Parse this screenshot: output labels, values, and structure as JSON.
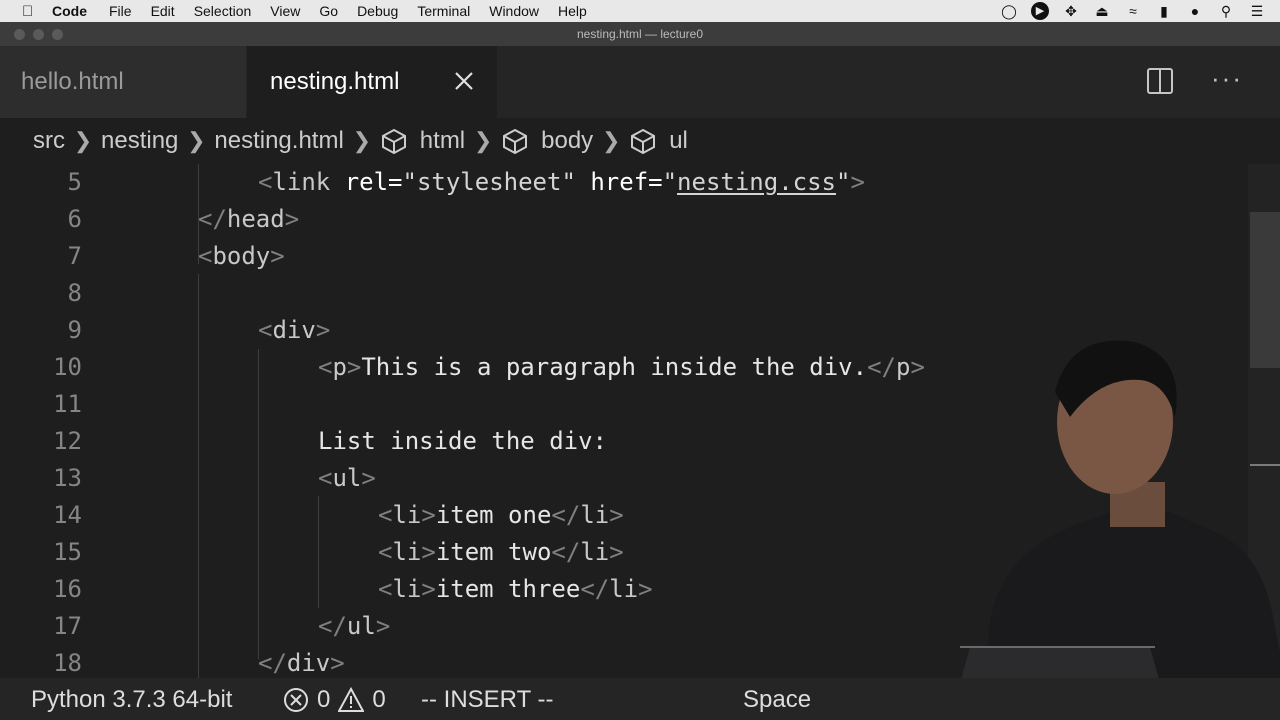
{
  "menubar": {
    "app": "Code",
    "items": [
      "File",
      "Edit",
      "Selection",
      "View",
      "Go",
      "Debug",
      "Terminal",
      "Window",
      "Help"
    ]
  },
  "window": {
    "title": "nesting.html — lecture0"
  },
  "tabs": [
    {
      "label": "hello.html",
      "active": false
    },
    {
      "label": "nesting.html",
      "active": true
    }
  ],
  "breadcrumb": [
    "src",
    "nesting",
    "nesting.html",
    "html",
    "body",
    "ul"
  ],
  "editor": {
    "lines": [
      {
        "num": "5",
        "tokens": [
          [
            "punct",
            "<"
          ],
          [
            "tag",
            "link "
          ],
          [
            "attr",
            "rel="
          ],
          [
            "str",
            "\"stylesheet\" "
          ],
          [
            "attr",
            "href="
          ],
          [
            "str",
            "\""
          ],
          [
            "link",
            "nesting.css"
          ],
          [
            "str",
            "\""
          ],
          [
            "punct",
            ">"
          ]
        ]
      },
      {
        "num": "6",
        "tokens": [
          [
            "punct",
            "</"
          ],
          [
            "tag",
            "head"
          ],
          [
            "punct",
            ">"
          ]
        ]
      },
      {
        "num": "7",
        "tokens": [
          [
            "punct",
            "<"
          ],
          [
            "tag",
            "body"
          ],
          [
            "punct",
            ">"
          ]
        ]
      },
      {
        "num": "8",
        "tokens": []
      },
      {
        "num": "9",
        "tokens": [
          [
            "punct",
            "<"
          ],
          [
            "tag",
            "div"
          ],
          [
            "punct",
            ">"
          ]
        ]
      },
      {
        "num": "10",
        "tokens": [
          [
            "punct",
            "<"
          ],
          [
            "tag",
            "p"
          ],
          [
            "punct",
            ">"
          ],
          [
            "txt",
            "This is a paragraph inside the div."
          ],
          [
            "punct",
            "</"
          ],
          [
            "tag",
            "p"
          ],
          [
            "punct",
            ">"
          ]
        ]
      },
      {
        "num": "11",
        "tokens": []
      },
      {
        "num": "12",
        "tokens": [
          [
            "txt",
            "List inside the div:"
          ]
        ]
      },
      {
        "num": "13",
        "tokens": [
          [
            "punct",
            "<"
          ],
          [
            "tag",
            "ul"
          ],
          [
            "punct",
            ">"
          ]
        ]
      },
      {
        "num": "14",
        "tokens": [
          [
            "punct",
            "<"
          ],
          [
            "tag",
            "li"
          ],
          [
            "punct",
            ">"
          ],
          [
            "txt",
            "item one"
          ],
          [
            "punct",
            "</"
          ],
          [
            "tag",
            "li"
          ],
          [
            "punct",
            ">"
          ]
        ]
      },
      {
        "num": "15",
        "tokens": [
          [
            "punct",
            "<"
          ],
          [
            "tag",
            "li"
          ],
          [
            "punct",
            ">"
          ],
          [
            "txt",
            "item two"
          ],
          [
            "punct",
            "</"
          ],
          [
            "tag",
            "li"
          ],
          [
            "punct",
            ">"
          ]
        ]
      },
      {
        "num": "16",
        "tokens": [
          [
            "punct",
            "<"
          ],
          [
            "tag",
            "li"
          ],
          [
            "punct",
            ">"
          ],
          [
            "txt",
            "item three"
          ],
          [
            "punct",
            "</"
          ],
          [
            "tag",
            "li"
          ],
          [
            "punct",
            ">"
          ]
        ]
      },
      {
        "num": "17",
        "tokens": [
          [
            "punct",
            "</"
          ],
          [
            "tag",
            "ul"
          ],
          [
            "punct",
            ">"
          ]
        ]
      },
      {
        "num": "18",
        "tokens": [
          [
            "punct",
            "</"
          ],
          [
            "tag",
            "div"
          ],
          [
            "punct",
            ">"
          ]
        ]
      }
    ]
  },
  "statusbar": {
    "python": "Python 3.7.3 64-bit",
    "errors": "0",
    "warnings": "0",
    "mode": "-- INSERT --",
    "spaces": "Space"
  },
  "colors": {
    "editor_bg": "#1e1e1e",
    "tabbar_bg": "#252526",
    "statusbar_bg": "#252526"
  }
}
